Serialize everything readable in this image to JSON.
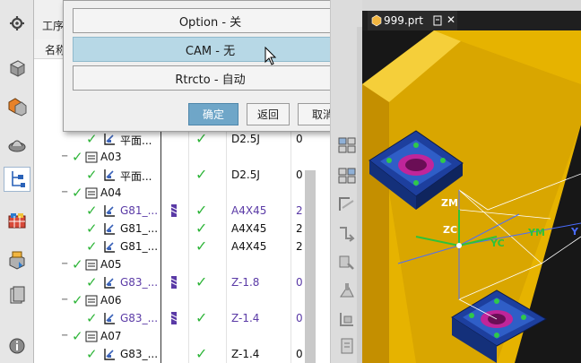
{
  "navigator": {
    "title": "工序导",
    "header_name": "名称"
  },
  "dialog": {
    "options": [
      {
        "label": "Option - 关"
      },
      {
        "label": "CAM - 无"
      },
      {
        "label": "Rtrcto - 自动"
      }
    ],
    "ok_label": "确定",
    "back_label": "返回",
    "cancel_label": "取消"
  },
  "operations": [
    {
      "name": "平面...",
      "tool": "D2.5J",
      "num": "0",
      "type": "op"
    },
    {
      "name": "A03",
      "type": "group"
    },
    {
      "name": "平面...",
      "tool": "D2.5J",
      "num": "0",
      "type": "op"
    },
    {
      "name": "A04",
      "type": "group"
    },
    {
      "name": "G81_...",
      "tool": "A4X45",
      "num": "2",
      "type": "op",
      "modified": true
    },
    {
      "name": "G81_...",
      "tool": "A4X45",
      "num": "2",
      "type": "op"
    },
    {
      "name": "G81_...",
      "tool": "A4X45",
      "num": "2",
      "type": "op"
    },
    {
      "name": "A05",
      "type": "group"
    },
    {
      "name": "G83_...",
      "tool": "Z-1.8",
      "num": "0",
      "type": "op",
      "modified": true
    },
    {
      "name": "A06",
      "type": "group"
    },
    {
      "name": "G83_...",
      "tool": "Z-1.4",
      "num": "0",
      "type": "op",
      "modified": true
    },
    {
      "name": "A07",
      "type": "group"
    },
    {
      "name": "G83_...",
      "tool": "Z-1.4",
      "num": "0",
      "type": "op"
    }
  ],
  "graphics": {
    "tab_label": "999.prt",
    "axis_zm": "ZM",
    "axis_zc": "ZC",
    "axis_yc": "YC",
    "axis_ym": "YM",
    "axis_y": "Y",
    "colors": {
      "part": "#e8b800",
      "wcs": "#4a6cff",
      "mcs": "#2ec23a",
      "fixture": "#1d3f9e"
    }
  },
  "icons": [
    "gear-icon",
    "part-navigator-icon",
    "assembly-icon",
    "feature-icon",
    "operation-navigator-icon",
    "machine-tool-icon",
    "reuse-library-icon",
    "history-icon",
    "info-icon"
  ]
}
